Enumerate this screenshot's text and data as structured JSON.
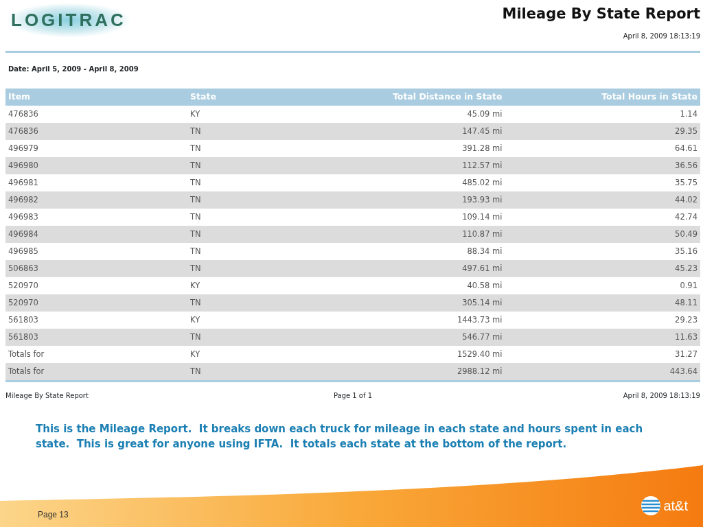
{
  "report": {
    "logo": "LOGITRAC",
    "title": "Mileage By State Report",
    "generated": "April 8, 2009 18:13:19",
    "date_range": "Date: April 5, 2009 - April 8, 2009",
    "table": {
      "columns": [
        "Item",
        "State",
        "Total Distance in State",
        "Total Hours in State"
      ],
      "rows": [
        [
          "476836",
          "KY",
          "45.09 mi",
          "1.14"
        ],
        [
          "476836",
          "TN",
          "147.45 mi",
          "29.35"
        ],
        [
          "496979",
          "TN",
          "391.28 mi",
          "64.61"
        ],
        [
          "496980",
          "TN",
          "112.57 mi",
          "36.56"
        ],
        [
          "496981",
          "TN",
          "485.02 mi",
          "35.75"
        ],
        [
          "496982",
          "TN",
          "193.93 mi",
          "44.02"
        ],
        [
          "496983",
          "TN",
          "109.14 mi",
          "42.74"
        ],
        [
          "496984",
          "TN",
          "110.87 mi",
          "50.49"
        ],
        [
          "496985",
          "TN",
          "88.34 mi",
          "35.16"
        ],
        [
          "506863",
          "TN",
          "497.61 mi",
          "45.23"
        ],
        [
          "520970",
          "KY",
          "40.58 mi",
          "0.91"
        ],
        [
          "520970",
          "TN",
          "305.14 mi",
          "48.11"
        ],
        [
          "561803",
          "KY",
          "1443.73 mi",
          "29.23"
        ],
        [
          "561803",
          "TN",
          "546.77 mi",
          "11.63"
        ],
        [
          "Totals for",
          "KY",
          "1529.40 mi",
          "31.27"
        ],
        [
          "Totals for",
          "TN",
          "2988.12 mi",
          "443.64"
        ]
      ]
    },
    "footer": {
      "left": "Mileage By State Report",
      "center": "Page 1 of 1",
      "right": "April 8, 2009 18:13:19"
    }
  },
  "caption": "This is the Mileage Report.  It breaks down each truck for mileage in each state and hours spent in each state.  This is great for anyone using IFTA.  It totals each state at the bottom of the report.",
  "slide_footer": {
    "page": "Page 13",
    "brand": "at&t"
  }
}
